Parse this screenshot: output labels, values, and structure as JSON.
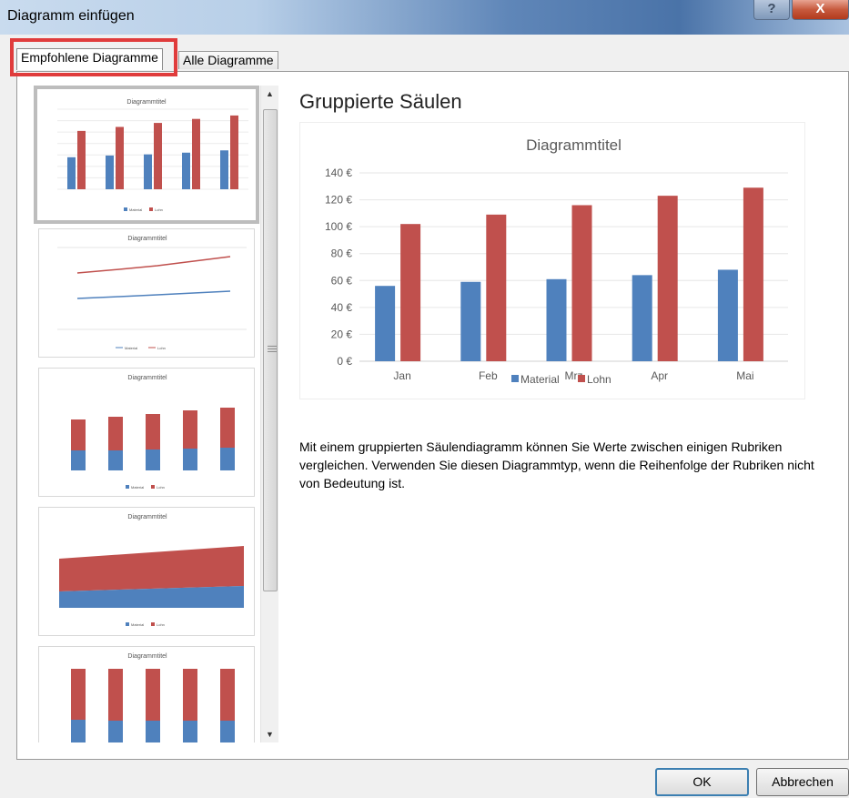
{
  "window": {
    "title": "Diagramm einfügen",
    "help_label": "?",
    "close_label": "X"
  },
  "tabs": [
    {
      "label": "Empfohlene Diagramme",
      "selected": true
    },
    {
      "label": "Alle Diagramme",
      "selected": false
    }
  ],
  "colors": {
    "material": "#4f81bd",
    "lohn": "#c0504d",
    "accent_highlight": "#e03c3c"
  },
  "thumbnails": [
    {
      "name": "clustered-column",
      "title": "Diagrammtitel",
      "legend": [
        "Material",
        "Lohn"
      ]
    },
    {
      "name": "line",
      "title": "Diagrammtitel",
      "legend": [
        "Material",
        "Lohn"
      ]
    },
    {
      "name": "stacked-column",
      "title": "Diagrammtitel",
      "legend": [
        "Material",
        "Lohn"
      ]
    },
    {
      "name": "stacked-area",
      "title": "Diagrammtitel",
      "legend": [
        "Material",
        "Lohn"
      ]
    },
    {
      "name": "100-stacked-column",
      "title": "Diagrammtitel"
    }
  ],
  "preview": {
    "heading": "Gruppierte Säulen",
    "description": "Mit einem gruppierten Säulendiagramm können Sie Werte zwischen einigen Rubriken vergleichen. Verwenden Sie diesen Diagrammtyp, wenn die Reihenfolge der Rubriken nicht von Bedeutung ist."
  },
  "chart_data": [
    {
      "type": "bar",
      "title": "Diagrammtitel",
      "categories": [
        "Jan",
        "Feb",
        "Mrz",
        "Apr",
        "Mai"
      ],
      "series": [
        {
          "name": "Material",
          "values": [
            56,
            59,
            61,
            64,
            68
          ]
        },
        {
          "name": "Lohn",
          "values": [
            102,
            109,
            116,
            123,
            129
          ]
        }
      ],
      "yticks": [
        "0 €",
        "20 €",
        "40 €",
        "60 €",
        "80 €",
        "100 €",
        "120 €",
        "140 €"
      ],
      "ylim": [
        0,
        140
      ],
      "grid": true,
      "legend": "bottom"
    }
  ],
  "buttons": {
    "ok": "OK",
    "cancel": "Abbrechen"
  }
}
